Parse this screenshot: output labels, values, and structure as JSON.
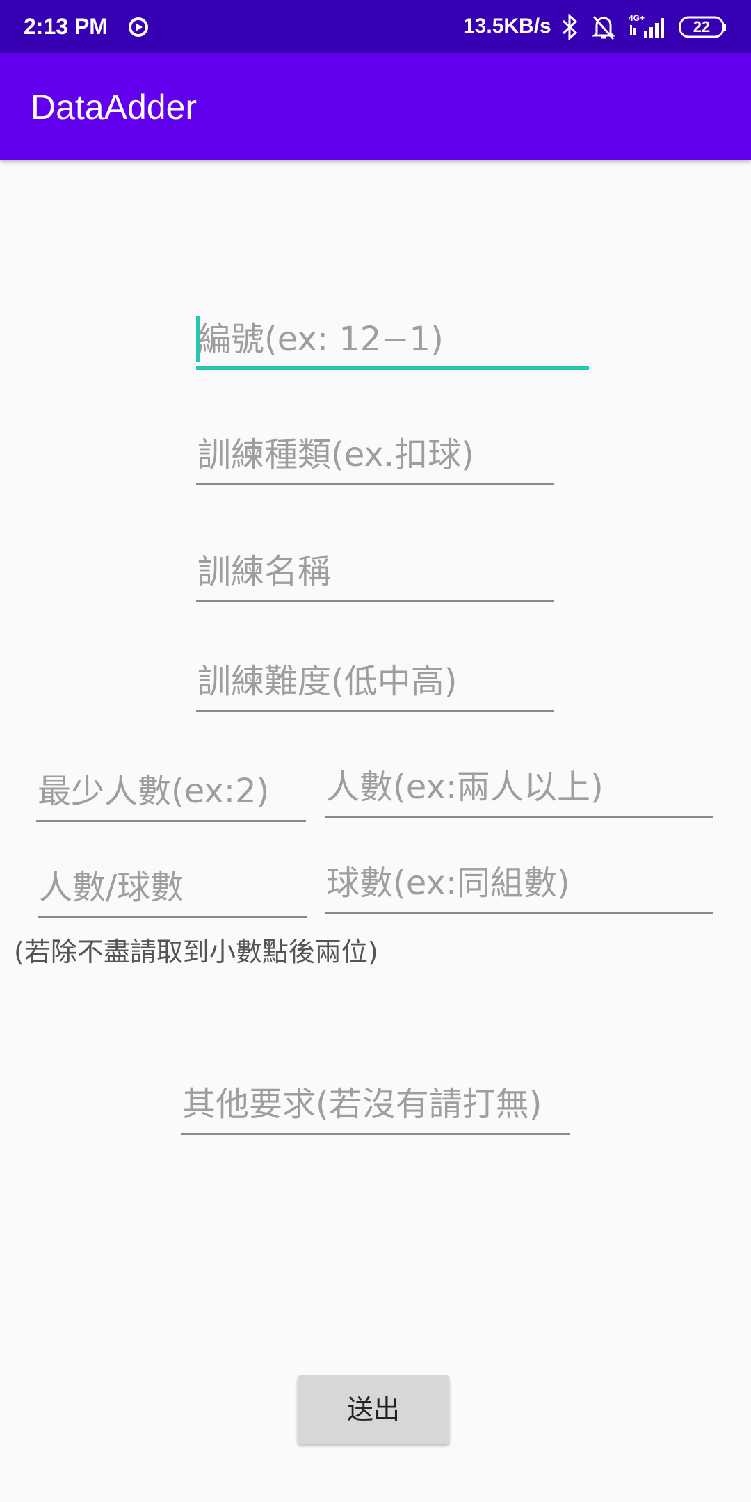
{
  "status_bar": {
    "time": "2:13 PM",
    "network_speed": "13.5KB/s",
    "battery": "22",
    "icons": [
      "cast-icon",
      "bluetooth-icon",
      "bell-off-icon",
      "signal-4g-icon",
      "battery-icon"
    ]
  },
  "app_bar": {
    "title": "DataAdder"
  },
  "form": {
    "id_placeholder": "編號(ex: 12−1)",
    "type_placeholder": "訓練種類(ex.扣球)",
    "name_placeholder": "訓練名稱",
    "difficulty_placeholder": "訓練難度(低中高)",
    "min_people_placeholder": "最少人數(ex:2)",
    "people_placeholder": "人數(ex:兩人以上)",
    "ratio_placeholder": "人數/球數",
    "balls_placeholder": "球數(ex:同組數)",
    "ratio_hint": "(若除不盡請取到小數點後兩位)",
    "other_placeholder": "其他要求(若沒有請打無)",
    "submit_label": "送出"
  },
  "colors": {
    "status_bar": "#3700B3",
    "app_bar": "#6200EE",
    "accent": "#26C6B4",
    "background": "#FAFAFA"
  }
}
